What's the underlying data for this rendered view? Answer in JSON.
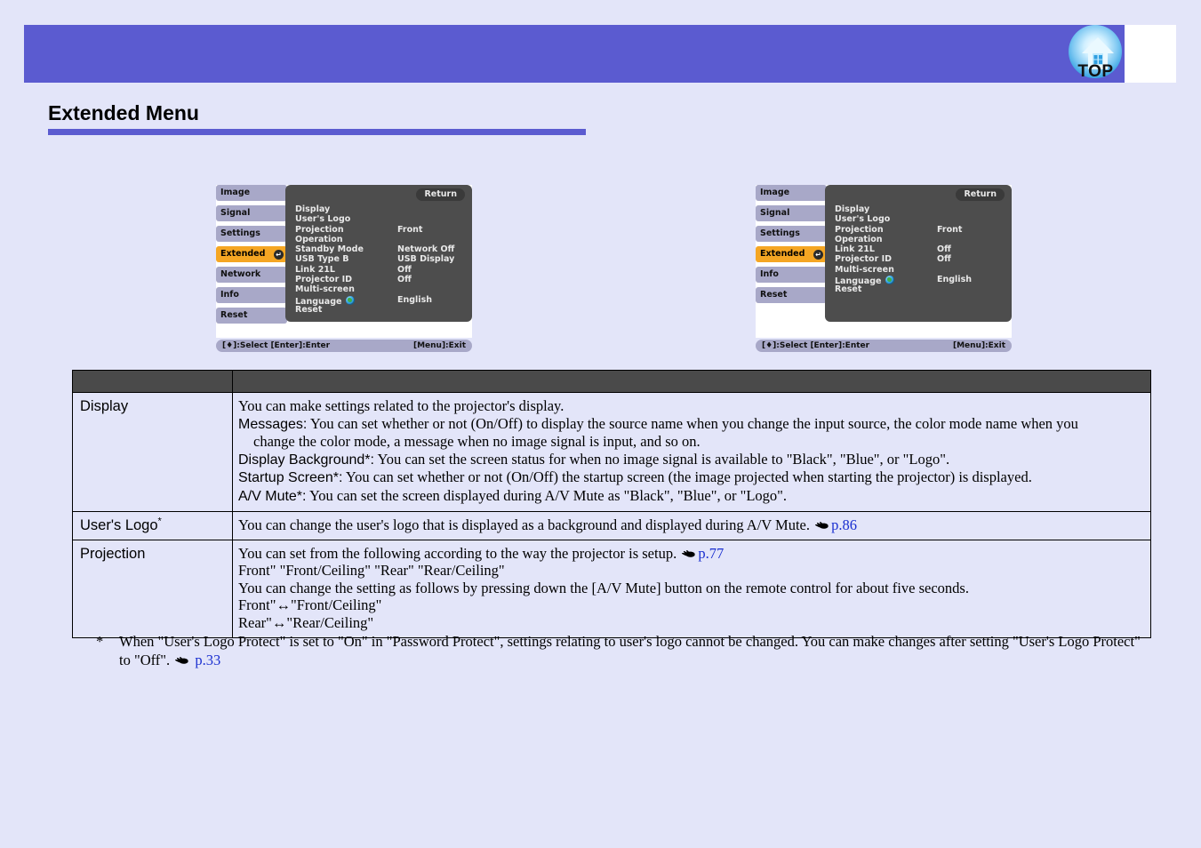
{
  "header": {
    "top_icon_label": "TOP",
    "top_icon_name": "home-top-icon"
  },
  "page": {
    "title": "Extended Menu"
  },
  "osd_left": {
    "sidebar": [
      {
        "label": "Image",
        "selected": false
      },
      {
        "label": "Signal",
        "selected": false
      },
      {
        "label": "Settings",
        "selected": false
      },
      {
        "label": "Extended",
        "selected": true
      },
      {
        "label": "Network",
        "selected": false
      },
      {
        "label": "Info",
        "selected": false
      },
      {
        "label": "Reset",
        "selected": false
      }
    ],
    "return_label": "Return",
    "rows": [
      {
        "label": "Display",
        "value": ""
      },
      {
        "label": "User's Logo",
        "value": ""
      },
      {
        "label": "Projection",
        "value": "Front"
      },
      {
        "label": "Operation",
        "value": ""
      },
      {
        "label": "Standby Mode",
        "value": "Network Off"
      },
      {
        "label": "USB Type B",
        "value": "USB Display"
      },
      {
        "label": "Link 21L",
        "value": "Off"
      },
      {
        "label": "Projector ID",
        "value": "Off"
      },
      {
        "label": "Multi-screen",
        "value": ""
      },
      {
        "label": "Language",
        "value": "English",
        "icon": "globe-icon"
      },
      {
        "label": "Reset",
        "value": ""
      }
    ],
    "footer_left": "[♦]:Select  [Enter]:Enter",
    "footer_right": "[Menu]:Exit"
  },
  "osd_right": {
    "sidebar": [
      {
        "label": "Image",
        "selected": false
      },
      {
        "label": "Signal",
        "selected": false
      },
      {
        "label": "Settings",
        "selected": false
      },
      {
        "label": "Extended",
        "selected": true
      },
      {
        "label": "Info",
        "selected": false
      },
      {
        "label": "Reset",
        "selected": false
      }
    ],
    "return_label": "Return",
    "rows": [
      {
        "label": "Display",
        "value": ""
      },
      {
        "label": "User's Logo",
        "value": ""
      },
      {
        "label": "Projection",
        "value": "Front"
      },
      {
        "label": "Operation",
        "value": ""
      },
      {
        "label": "Link 21L",
        "value": "Off"
      },
      {
        "label": "Projector ID",
        "value": "Off"
      },
      {
        "label": "Multi-screen",
        "value": ""
      },
      {
        "label": "Language",
        "value": "English",
        "icon": "globe-icon"
      },
      {
        "label": "Reset",
        "value": ""
      }
    ],
    "footer_left": "[♦]:Select  [Enter]:Enter",
    "footer_right": "[Menu]:Exit"
  },
  "table": {
    "rows": [
      {
        "label": "Display",
        "label_has_star": false,
        "lines": [
          {
            "text": "You can make settings related to the projector's display."
          },
          {
            "term": "Messages:",
            "text": " You can set whether or not (On/Off) to display the source name when you change the input source, the color mode name when you"
          },
          {
            "indent": true,
            "text": "change the color mode, a message when no image signal is input, and so on."
          },
          {
            "term": "Display Background*:",
            "text": " You can set the screen status for when no image signal is available to \"Black\", \"Blue\", or \"Logo\"."
          },
          {
            "term": "Startup Screen*:",
            "text": " You can set whether or not (On/Off) the startup screen (the image projected when starting the projector) is displayed."
          },
          {
            "term": "A/V Mute*:",
            "text": " You can set the screen displayed during A/V Mute as \"Black\", \"Blue\", or \"Logo\"."
          }
        ]
      },
      {
        "label": "User's Logo",
        "label_has_star": true,
        "lines": [
          {
            "text": "You can change the user's logo that is displayed as a background and displayed during A/V Mute.",
            "link": "p.86"
          }
        ]
      },
      {
        "label": "Projection",
        "label_has_star": false,
        "lines": [
          {
            "text": "You can set from the following according to the way the projector is setup.",
            "link": "p.77"
          },
          {
            "text": "Front\" \"Front/Ceiling\" \"Rear\" \"Rear/Ceiling\""
          },
          {
            "text": "You can change the setting as follows by pressing down the [A/V Mute] button on the remote control for about five seconds."
          },
          {
            "text": "Front\"↔\"Front/Ceiling\""
          },
          {
            "text": "Rear\"↔\"Rear/Ceiling\""
          }
        ]
      }
    ]
  },
  "footnote": {
    "star": "*",
    "text_before_link": "When \"User's Logo Protect\" is set to \"On\" in \"Password Protect\", settings relating to user's logo cannot be changed. You can make changes after setting \"User's Logo Protect\" to \"Off\".",
    "link": "p.33"
  },
  "colors": {
    "page_bg": "#e3e5f9",
    "header_band": "#5b5bd0",
    "title_rule": "#5b5bd0",
    "table_header": "#4a4a4a",
    "osd_panel": "#4d4d4d",
    "osd_selected": "#f5a623",
    "osd_sidebar_item": "#a8a8c8",
    "link": "#1a2fd0"
  }
}
